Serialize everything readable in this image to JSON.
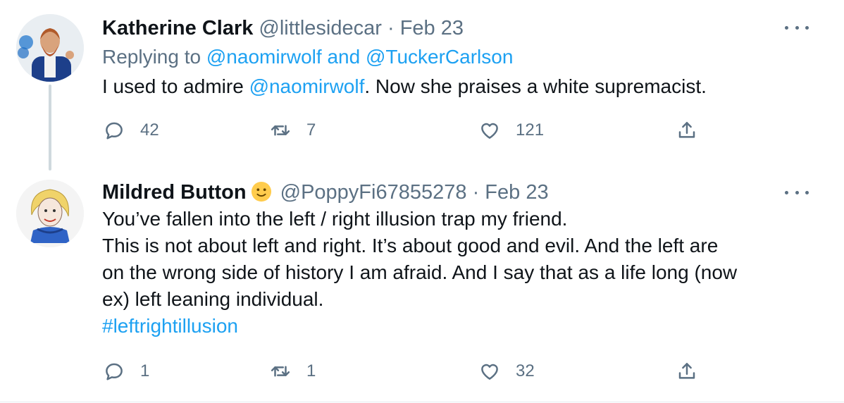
{
  "tweets": [
    {
      "display_name": "Katherine Clark",
      "handle": "@littlesidecar",
      "separator": "·",
      "date": "Feb 23",
      "replying_prefix": "Replying to",
      "replying_user_1": "@naomirwolf",
      "replying_and": "and",
      "replying_user_2": "@TuckerCarlson",
      "text_before_mention": "I used to admire",
      "text_mention": "@naomirwolf",
      "text_after_mention": ". Now she praises a white supremacist.",
      "replies": "42",
      "retweets": "7",
      "likes": "121"
    },
    {
      "display_name": "Mildred Button",
      "name_emoji": "slightly-smiling-face",
      "handle": "@PoppyFi67855278",
      "separator": "·",
      "date": "Feb 23",
      "text_lines": [
        "You’ve fallen into the left / right illusion trap my friend.",
        "This is not about left and right. It’s about good and evil. And the left are",
        "on the wrong side of history I am afraid. And I say that as a life long (now",
        "ex) left leaning individual."
      ],
      "hashtag": "#leftrightillusion",
      "replies": "1",
      "retweets": "1",
      "likes": "32"
    }
  ],
  "icons": {
    "reply": "reply-icon",
    "retweet": "retweet-icon",
    "like": "heart-icon",
    "share": "share-icon",
    "more": "more-icon"
  },
  "colors": {
    "link": "#1da1f2",
    "muted": "#5b7083",
    "text": "#0f1419",
    "thread_line": "#cfd9de"
  }
}
